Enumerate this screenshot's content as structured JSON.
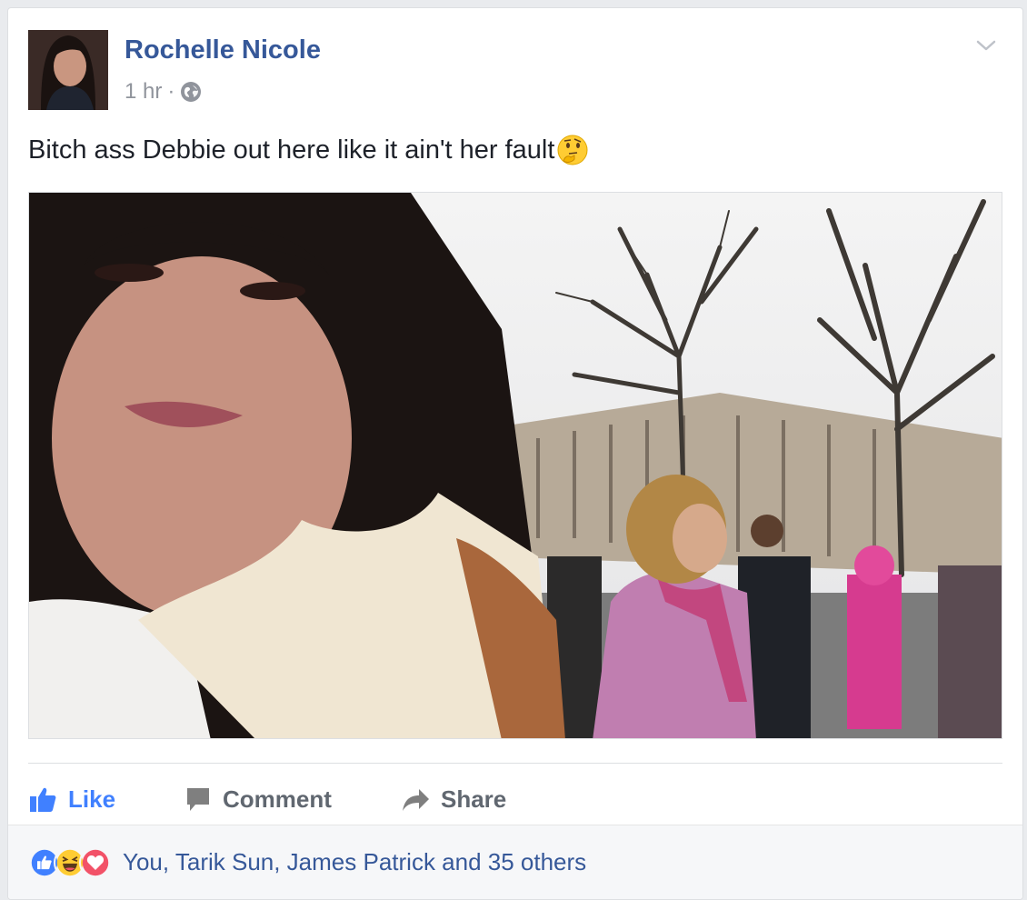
{
  "post": {
    "author": "Rochelle Nicole",
    "time": "1 hr",
    "separator": "·",
    "privacy_icon": "globe-icon",
    "text": "Bitch ass Debbie out here like it ain't her fault",
    "text_emoji": "thinking-face-emoji"
  },
  "actions": {
    "like": "Like",
    "comment": "Comment",
    "share": "Share"
  },
  "reactions": {
    "icons": [
      "like-reaction-icon",
      "haha-reaction-icon",
      "love-reaction-icon"
    ],
    "summary": "You, Tarik Sun, James Patrick and 35 others"
  },
  "colors": {
    "link_blue": "#365899",
    "like_blue": "#4080ff",
    "action_gray": "#606770",
    "love_red": "#f25268"
  }
}
